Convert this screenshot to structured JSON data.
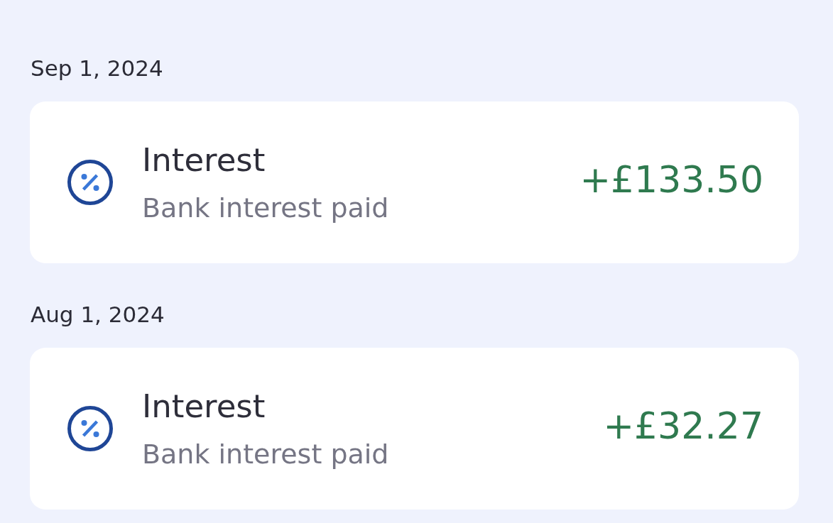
{
  "groups": [
    {
      "date": "Sep 1, 2024",
      "transactions": [
        {
          "title": "Interest",
          "description": "Bank interest paid",
          "amount": "+£133.50"
        }
      ]
    },
    {
      "date": "Aug 1, 2024",
      "transactions": [
        {
          "title": "Interest",
          "description": "Bank interest paid",
          "amount": "+£32.27"
        }
      ]
    }
  ]
}
